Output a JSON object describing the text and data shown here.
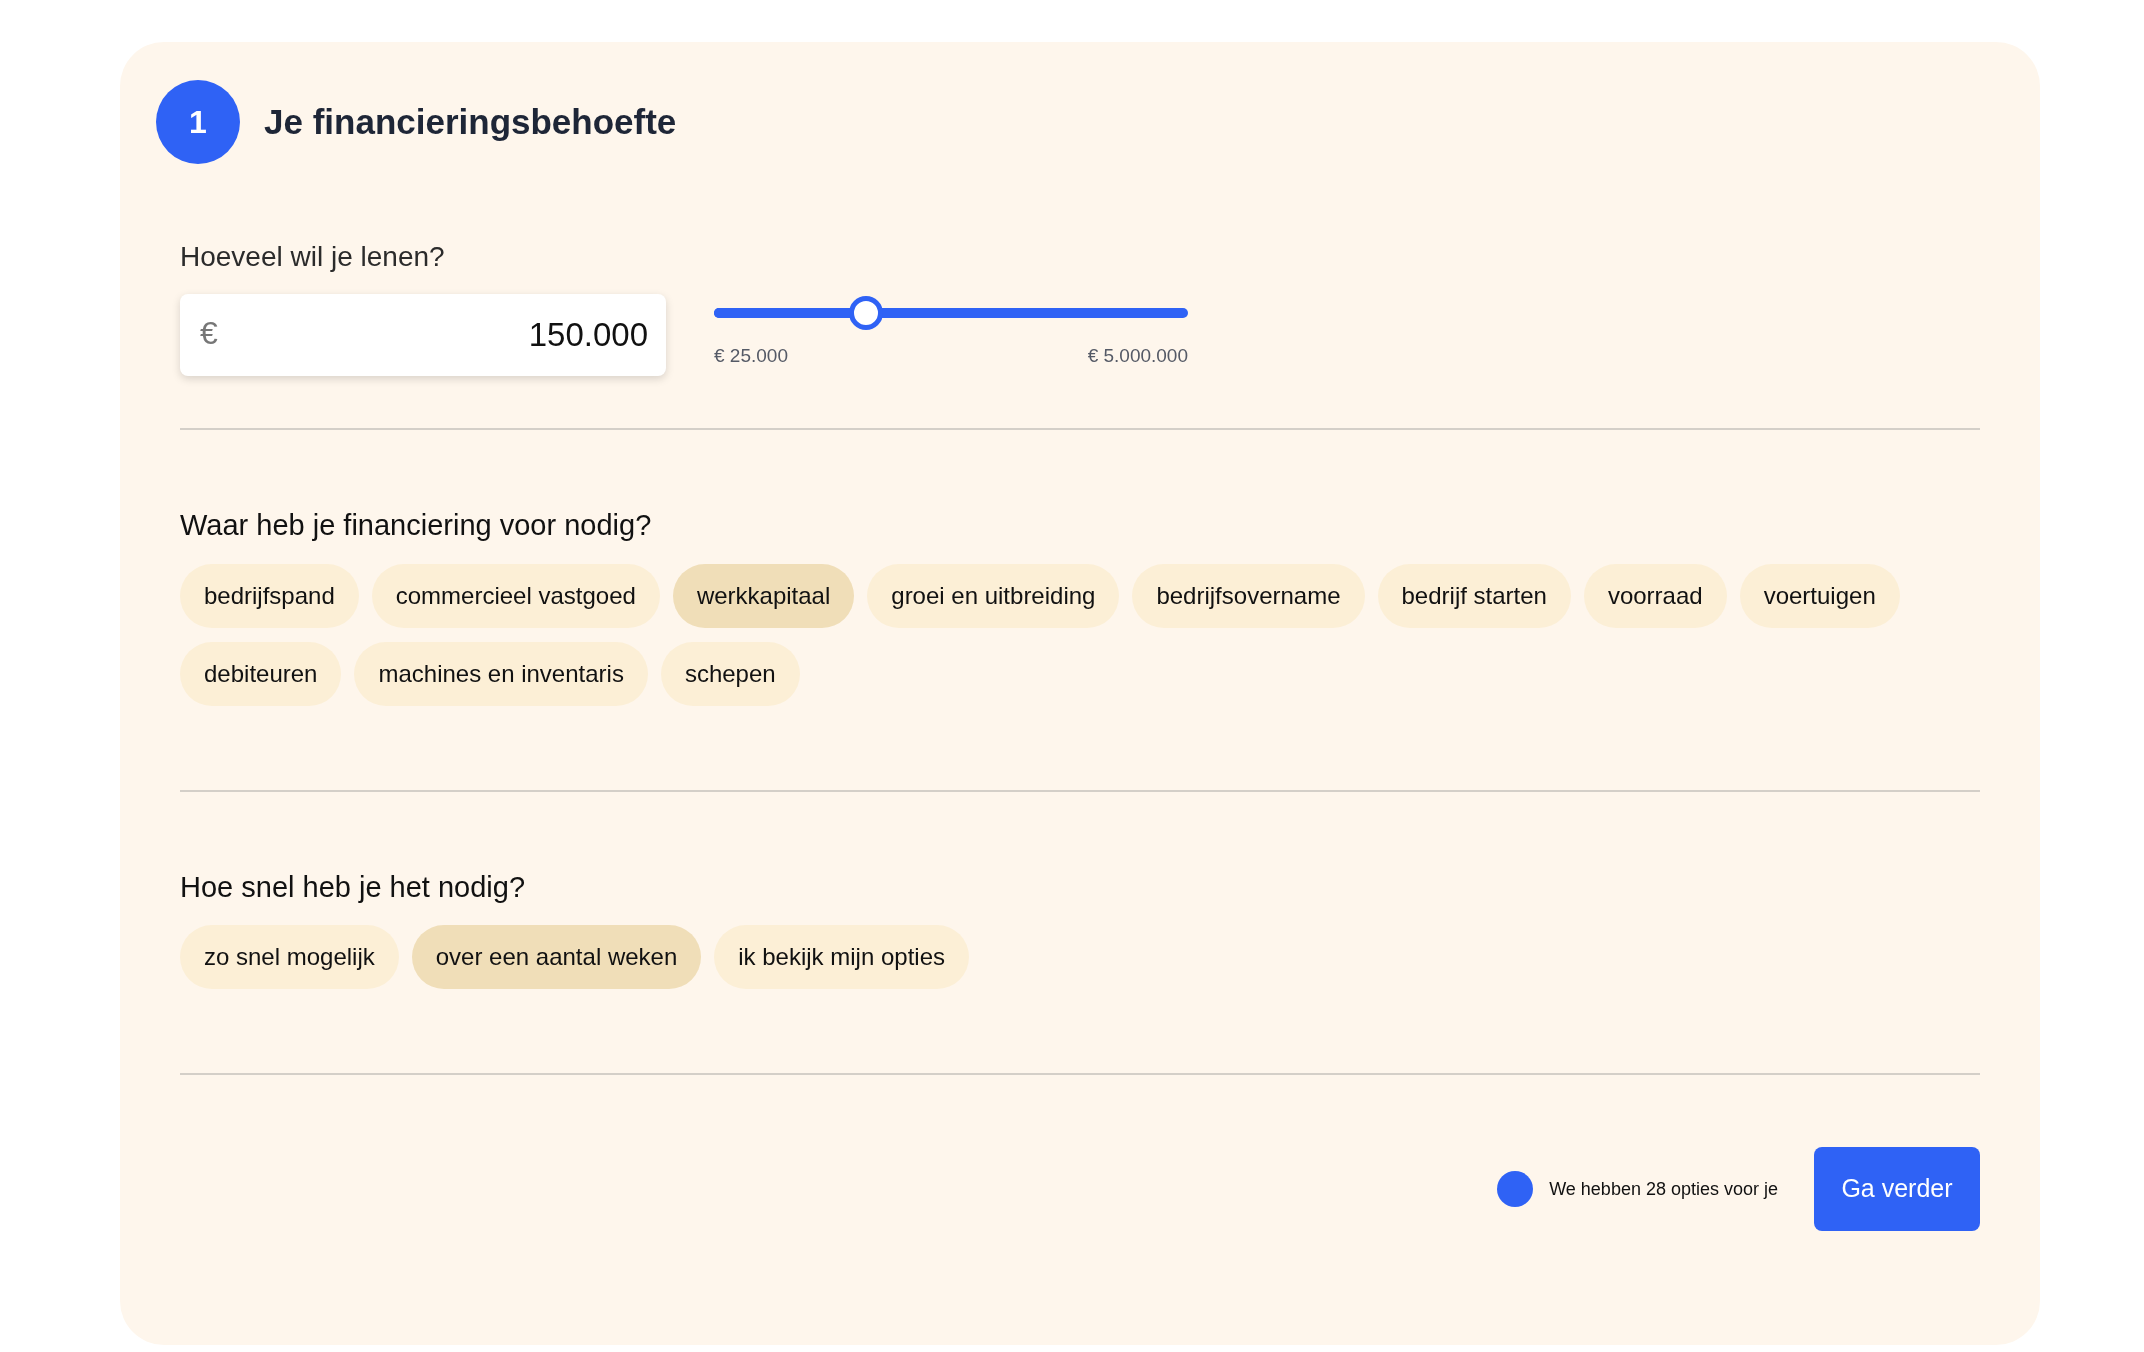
{
  "step": {
    "number": "1",
    "title": "Je financieringsbehoefte"
  },
  "amount": {
    "label": "Hoeveel wil je lenen?",
    "currency": "€",
    "value": "150.000",
    "slider": {
      "level": 0.32,
      "min_label": "€ 25.000",
      "max_label": "€ 5.000.000"
    }
  },
  "purpose": {
    "question": "Waar heb je financiering voor nodig?",
    "options": [
      {
        "label": "bedrijfspand",
        "selected": false
      },
      {
        "label": "commercieel vastgoed",
        "selected": false
      },
      {
        "label": "werkkapitaal",
        "selected": true
      },
      {
        "label": "groei en uitbreiding",
        "selected": false
      },
      {
        "label": "bedrijfsovername",
        "selected": false
      },
      {
        "label": "bedrijf starten",
        "selected": false
      },
      {
        "label": "voorraad",
        "selected": false
      },
      {
        "label": "voertuigen",
        "selected": false
      },
      {
        "label": "debiteuren",
        "selected": false
      },
      {
        "label": "machines en inventaris",
        "selected": false
      },
      {
        "label": "schepen",
        "selected": false
      }
    ]
  },
  "timing": {
    "question": "Hoe snel heb je het nodig?",
    "options": [
      {
        "label": "zo snel mogelijk",
        "selected": false
      },
      {
        "label": "over een aantal weken",
        "selected": true
      },
      {
        "label": "ik bekijk mijn opties",
        "selected": false
      }
    ]
  },
  "footer": {
    "status": "We hebben 28 opties voor je",
    "button": "Ga verder"
  }
}
